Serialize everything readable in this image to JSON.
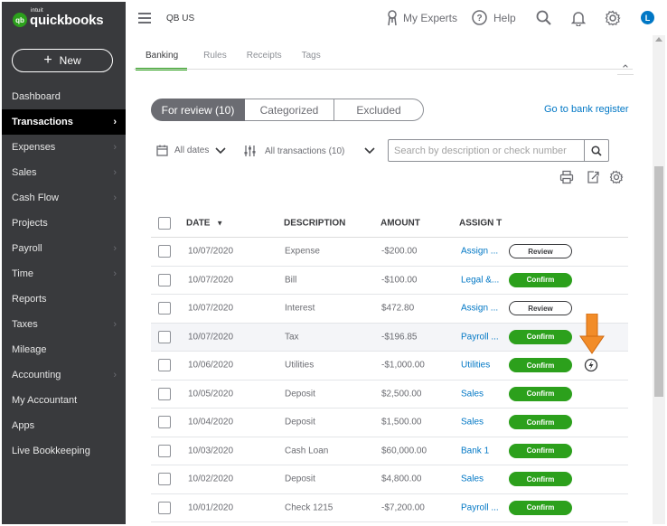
{
  "sidebar": {
    "logo": {
      "mark": "qb",
      "small": "intuit",
      "name": "quickbooks"
    },
    "new_button": "New",
    "items": [
      {
        "label": "Dashboard",
        "chevron": false
      },
      {
        "label": "Transactions",
        "chevron": true,
        "active": true
      },
      {
        "label": "Expenses",
        "chevron": true
      },
      {
        "label": "Sales",
        "chevron": true
      },
      {
        "label": "Cash Flow",
        "chevron": true
      },
      {
        "label": "Projects",
        "chevron": false
      },
      {
        "label": "Payroll",
        "chevron": true
      },
      {
        "label": "Time",
        "chevron": true
      },
      {
        "label": "Reports",
        "chevron": false
      },
      {
        "label": "Taxes",
        "chevron": true
      },
      {
        "label": "Mileage",
        "chevron": false
      },
      {
        "label": "Accounting",
        "chevron": true
      },
      {
        "label": "My Accountant",
        "chevron": false
      },
      {
        "label": "Apps",
        "chevron": false
      },
      {
        "label": "Live Bookkeeping",
        "chevron": false
      }
    ]
  },
  "topbar": {
    "company": "QB US",
    "my_experts": "My Experts",
    "help": "Help",
    "avatar_letter": "L"
  },
  "tabs": [
    "Banking",
    "Rules",
    "Receipts",
    "Tags"
  ],
  "segments": {
    "for_review": "For review (10)",
    "categorized": "Categorized",
    "excluded": "Excluded"
  },
  "goto_link": "Go to bank register",
  "filters": {
    "dates": "All dates",
    "transactions": "All transactions (10)"
  },
  "search": {
    "placeholder": "Search by description or check number"
  },
  "table": {
    "headers": {
      "date": "DATE",
      "sort_indicator": "▼",
      "description": "DESCRIPTION",
      "amount": "AMOUNT",
      "assign": "ASSIGN T"
    },
    "rows": [
      {
        "date": "10/07/2020",
        "description": "Expense",
        "amount": "-$200.00",
        "assign": "Assign ...",
        "action": "Review"
      },
      {
        "date": "10/07/2020",
        "description": "Bill",
        "amount": "-$100.00",
        "assign": "Legal &...",
        "action": "Confirm"
      },
      {
        "date": "10/07/2020",
        "description": "Interest",
        "amount": "$472.80",
        "assign": "Assign ...",
        "action": "Review"
      },
      {
        "date": "10/07/2020",
        "description": "Tax",
        "amount": "-$196.85",
        "assign": "Payroll ...",
        "action": "Confirm"
      },
      {
        "date": "10/06/2020",
        "description": "Utilities",
        "amount": "-$1,000.00",
        "assign": "Utilities",
        "action": "Confirm"
      },
      {
        "date": "10/05/2020",
        "description": "Deposit",
        "amount": "$2,500.00",
        "assign": "Sales",
        "action": "Confirm"
      },
      {
        "date": "10/04/2020",
        "description": "Deposit",
        "amount": "$1,500.00",
        "assign": "Sales",
        "action": "Confirm"
      },
      {
        "date": "10/03/2020",
        "description": "Cash Loan",
        "amount": "$60,000.00",
        "assign": "Bank 1",
        "action": "Confirm"
      },
      {
        "date": "10/02/2020",
        "description": "Deposit",
        "amount": "$4,800.00",
        "assign": "Sales",
        "action": "Confirm"
      },
      {
        "date": "10/01/2020",
        "description": "Check 1215",
        "amount": "-$7,200.00",
        "assign": "Payroll ...",
        "action": "Confirm"
      }
    ]
  },
  "colors": {
    "sidebar_bg": "#393a3d",
    "brand_green": "#2ca01c",
    "link_blue": "#0077c5",
    "annotation_arrow": "#f28c28"
  }
}
